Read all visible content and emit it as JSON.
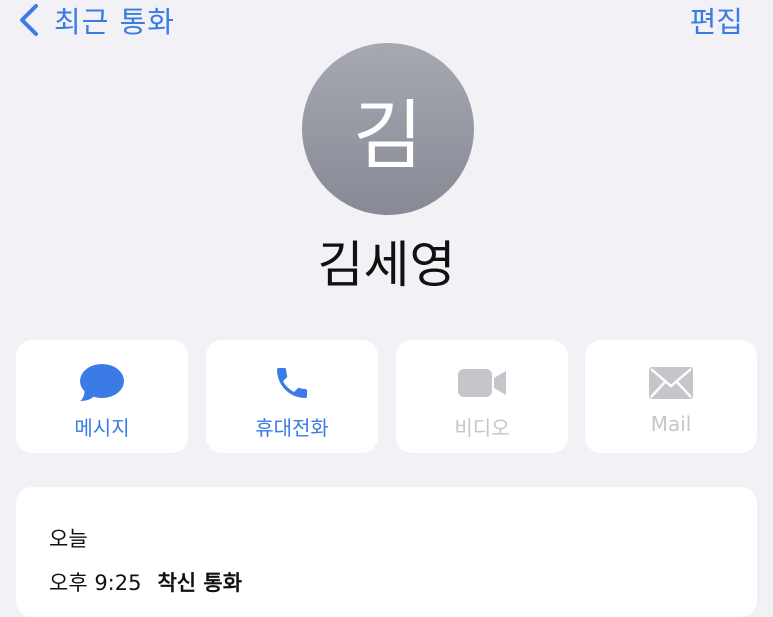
{
  "nav": {
    "back_label": "최근 통화",
    "edit_label": "편집"
  },
  "contact": {
    "initial": "김",
    "name": "김세영"
  },
  "actions": [
    {
      "label": "메시지",
      "icon": "message-bubble-icon",
      "enabled": true
    },
    {
      "label": "휴대전화",
      "icon": "phone-icon",
      "enabled": true
    },
    {
      "label": "비디오",
      "icon": "video-camera-icon",
      "enabled": false
    },
    {
      "label": "Mail",
      "icon": "mail-envelope-icon",
      "enabled": false
    }
  ],
  "history": {
    "date": "오늘",
    "entries": [
      {
        "time": "오후 9:25",
        "type": "착신 통화"
      }
    ]
  },
  "colors": {
    "accent": "#3a7be6",
    "disabled": "#c5c5cb",
    "background": "#f1f1f6"
  }
}
